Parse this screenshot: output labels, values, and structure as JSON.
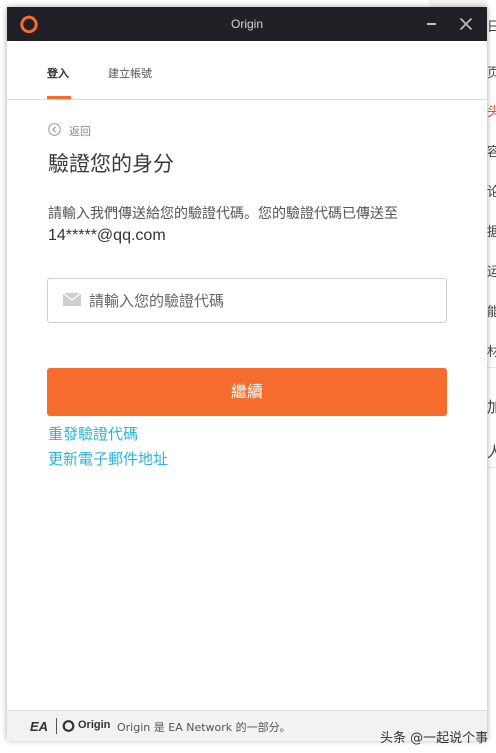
{
  "window": {
    "title": "Origin",
    "minimize_label": "–",
    "close_label": "✕"
  },
  "tabs": [
    {
      "label": "登入",
      "active": true
    },
    {
      "label": "建立帳號",
      "active": false
    }
  ],
  "back_label": "返回",
  "heading": "驗證您的身分",
  "description": "請輸入我們傳送給您的驗證代碼。您的驗證代碼已傳送至",
  "email": "14*****@qq.com",
  "code_input": {
    "placeholder": "請輸入您的驗證代碼",
    "value": "",
    "icon": "mail-icon"
  },
  "continue_label": "繼續",
  "links": {
    "resend": "重發驗證代碼",
    "update_email": "更新電子郵件地址"
  },
  "footer": {
    "ea_label": "EA",
    "origin_label": "Origin",
    "text": "Origin 是 EA Network 的一部分。"
  },
  "watermark": "头条 @一起说个事",
  "background_page": {
    "chars": [
      "日",
      "页",
      "头",
      "容",
      "论",
      "据",
      "运",
      "能",
      "材",
      "加",
      "人"
    ]
  },
  "colors": {
    "accent": "#f56c2d",
    "link": "#2bb5d8",
    "titlebar": "#1f2126"
  }
}
